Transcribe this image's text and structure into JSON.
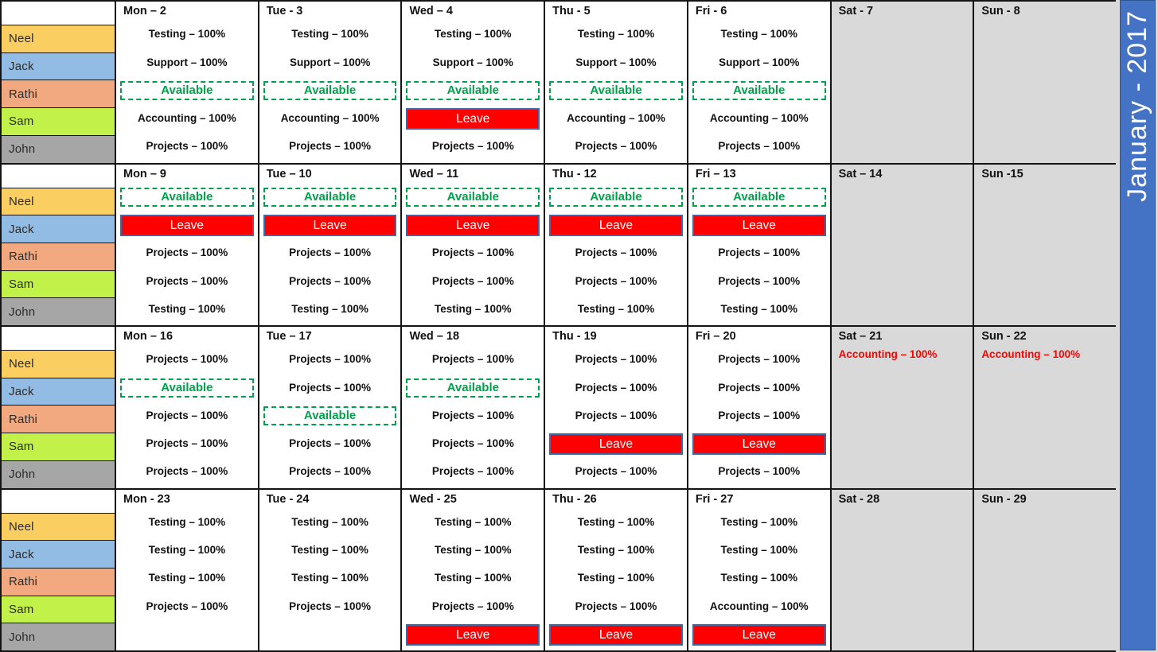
{
  "banner": {
    "month_year": "January - 2017",
    "accent": "#4472c4"
  },
  "resources": [
    {
      "name": "Neel",
      "color": "#fbce61"
    },
    {
      "name": "Jack",
      "color": "#92bce4"
    },
    {
      "name": "Rathi",
      "color": "#f2a97f"
    },
    {
      "name": "Sam",
      "color": "#c2f24a"
    },
    {
      "name": "John",
      "color": "#a6a6a6"
    }
  ],
  "status_colors": {
    "available_text": "#00a14b",
    "available_border": "#00a14b",
    "leave_bg": "#ff0000",
    "leave_border": "#3a68ab",
    "leave_text": "#ffffff",
    "weekend_bg": "#d9d9d9",
    "weekend_task_text": "#ff0000"
  },
  "weeks": [
    {
      "days": [
        {
          "label": "Mon – 2",
          "weekend": false,
          "slots": [
            {
              "type": "task",
              "text": "Testing – 100%"
            },
            {
              "type": "task",
              "text": "Support  – 100%"
            },
            {
              "type": "available",
              "text": "Available"
            },
            {
              "type": "task",
              "text": "Accounting  – 100%"
            },
            {
              "type": "task",
              "text": "Projects – 100%"
            }
          ]
        },
        {
          "label": "Tue - 3",
          "weekend": false,
          "slots": [
            {
              "type": "task",
              "text": "Testing – 100%"
            },
            {
              "type": "task",
              "text": "Support  – 100%"
            },
            {
              "type": "available",
              "text": "Available"
            },
            {
              "type": "task",
              "text": "Accounting  – 100%"
            },
            {
              "type": "task",
              "text": "Projects – 100%"
            }
          ]
        },
        {
          "label": "Wed – 4",
          "weekend": false,
          "slots": [
            {
              "type": "task",
              "text": "Testing – 100%"
            },
            {
              "type": "task",
              "text": "Support – 100%"
            },
            {
              "type": "available",
              "text": "Available"
            },
            {
              "type": "leave",
              "text": "Leave"
            },
            {
              "type": "task",
              "text": "Projects – 100%"
            }
          ]
        },
        {
          "label": "Thu - 5",
          "weekend": false,
          "slots": [
            {
              "type": "task",
              "text": "Testing – 100%"
            },
            {
              "type": "task",
              "text": "Support – 100%"
            },
            {
              "type": "available",
              "text": "Available"
            },
            {
              "type": "task",
              "text": "Accounting  – 100%"
            },
            {
              "type": "task",
              "text": "Projects – 100%"
            }
          ]
        },
        {
          "label": "Fri - 6",
          "weekend": false,
          "slots": [
            {
              "type": "task",
              "text": "Testing – 100%"
            },
            {
              "type": "task",
              "text": "Support – 100%"
            },
            {
              "type": "available",
              "text": "Available"
            },
            {
              "type": "task",
              "text": "Accounting  – 100%"
            },
            {
              "type": "task",
              "text": "Projects – 100%"
            }
          ]
        },
        {
          "label": "Sat - 7",
          "weekend": true,
          "slots": []
        },
        {
          "label": "Sun - 8",
          "weekend": true,
          "slots": []
        }
      ]
    },
    {
      "days": [
        {
          "label": "Mon – 9",
          "weekend": false,
          "slots": [
            {
              "type": "available",
              "text": "Available"
            },
            {
              "type": "leave",
              "text": "Leave"
            },
            {
              "type": "task",
              "text": "Projects – 100%"
            },
            {
              "type": "task",
              "text": "Projects – 100%"
            },
            {
              "type": "task",
              "text": "Testing – 100%"
            }
          ]
        },
        {
          "label": "Tue – 10",
          "weekend": false,
          "slots": [
            {
              "type": "available",
              "text": "Available"
            },
            {
              "type": "leave",
              "text": "Leave"
            },
            {
              "type": "task",
              "text": "Projects – 100%"
            },
            {
              "type": "task",
              "text": "Projects – 100%"
            },
            {
              "type": "task",
              "text": "Testing – 100%"
            }
          ]
        },
        {
          "label": "Wed – 11",
          "weekend": false,
          "slots": [
            {
              "type": "available",
              "text": "Available"
            },
            {
              "type": "leave",
              "text": "Leave"
            },
            {
              "type": "task",
              "text": "Projects – 100%"
            },
            {
              "type": "task",
              "text": "Projects – 100%"
            },
            {
              "type": "task",
              "text": "Testing – 100%"
            }
          ]
        },
        {
          "label": "Thu - 12",
          "weekend": false,
          "slots": [
            {
              "type": "available",
              "text": "Available"
            },
            {
              "type": "leave",
              "text": "Leave"
            },
            {
              "type": "task",
              "text": "Projects – 100%"
            },
            {
              "type": "task",
              "text": "Projects – 100%"
            },
            {
              "type": "task",
              "text": "Testing – 100%"
            }
          ]
        },
        {
          "label": "Fri – 13",
          "weekend": false,
          "slots": [
            {
              "type": "available",
              "text": "Available"
            },
            {
              "type": "leave",
              "text": "Leave"
            },
            {
              "type": "task",
              "text": "Projects – 100%"
            },
            {
              "type": "task",
              "text": "Projects – 100%"
            },
            {
              "type": "task",
              "text": "Testing – 100%"
            }
          ]
        },
        {
          "label": "Sat – 14",
          "weekend": true,
          "slots": []
        },
        {
          "label": "Sun -15",
          "weekend": true,
          "slots": []
        }
      ]
    },
    {
      "days": [
        {
          "label": "Mon – 16",
          "weekend": false,
          "slots": [
            {
              "type": "task",
              "text": "Projects – 100%"
            },
            {
              "type": "available",
              "text": "Available"
            },
            {
              "type": "task",
              "text": "Projects – 100%"
            },
            {
              "type": "task",
              "text": "Projects – 100%"
            },
            {
              "type": "task",
              "text": "Projects – 100%"
            }
          ]
        },
        {
          "label": "Tue – 17",
          "weekend": false,
          "slots": [
            {
              "type": "task",
              "text": "Projects – 100%"
            },
            {
              "type": "task",
              "text": "Projects – 100%"
            },
            {
              "type": "available",
              "text": "Available"
            },
            {
              "type": "task",
              "text": "Projects – 100%"
            },
            {
              "type": "task",
              "text": "Projects – 100%"
            }
          ]
        },
        {
          "label": "Wed – 18",
          "weekend": false,
          "slots": [
            {
              "type": "task",
              "text": "Projects – 100%"
            },
            {
              "type": "available",
              "text": "Available"
            },
            {
              "type": "task",
              "text": "Projects – 100%"
            },
            {
              "type": "task",
              "text": "Projects – 100%"
            },
            {
              "type": "task",
              "text": "Projects – 100%"
            }
          ]
        },
        {
          "label": "Thu - 19",
          "weekend": false,
          "slots": [
            {
              "type": "task",
              "text": "Projects – 100%"
            },
            {
              "type": "task",
              "text": "Projects – 100%"
            },
            {
              "type": "task",
              "text": "Projects – 100%"
            },
            {
              "type": "leave",
              "text": "Leave"
            },
            {
              "type": "task",
              "text": "Projects – 100%"
            }
          ]
        },
        {
          "label": "Fri – 20",
          "weekend": false,
          "slots": [
            {
              "type": "task",
              "text": "Projects – 100%"
            },
            {
              "type": "task",
              "text": "Projects – 100%"
            },
            {
              "type": "task",
              "text": "Projects – 100%"
            },
            {
              "type": "leave",
              "text": "Leave"
            },
            {
              "type": "task",
              "text": "Projects – 100%"
            }
          ]
        },
        {
          "label": "Sat – 21",
          "weekend": true,
          "slots": [
            {
              "type": "weekend-task",
              "text": "Accounting  – 100%"
            }
          ]
        },
        {
          "label": "Sun - 22",
          "weekend": true,
          "slots": [
            {
              "type": "weekend-task",
              "text": "Accounting  – 100%"
            }
          ]
        }
      ]
    },
    {
      "days": [
        {
          "label": "Mon - 23",
          "weekend": false,
          "slots": [
            {
              "type": "task",
              "text": "Testing – 100%"
            },
            {
              "type": "task",
              "text": "Testing – 100%"
            },
            {
              "type": "task",
              "text": "Testing – 100%"
            },
            {
              "type": "task",
              "text": "Projects – 100%"
            },
            {
              "type": "empty",
              "text": ""
            }
          ]
        },
        {
          "label": "Tue - 24",
          "weekend": false,
          "slots": [
            {
              "type": "task",
              "text": "Testing – 100%"
            },
            {
              "type": "task",
              "text": "Testing – 100%"
            },
            {
              "type": "task",
              "text": "Testing – 100%"
            },
            {
              "type": "task",
              "text": "Projects – 100%"
            },
            {
              "type": "empty",
              "text": ""
            }
          ]
        },
        {
          "label": "Wed - 25",
          "weekend": false,
          "slots": [
            {
              "type": "task",
              "text": "Testing – 100%"
            },
            {
              "type": "task",
              "text": "Testing – 100%"
            },
            {
              "type": "task",
              "text": "Testing – 100%"
            },
            {
              "type": "task",
              "text": "Projects – 100%"
            },
            {
              "type": "leave",
              "text": "Leave"
            }
          ]
        },
        {
          "label": "Thu - 26",
          "weekend": false,
          "slots": [
            {
              "type": "task",
              "text": "Testing – 100%"
            },
            {
              "type": "task",
              "text": "Testing – 100%"
            },
            {
              "type": "task",
              "text": "Testing – 100%"
            },
            {
              "type": "task",
              "text": "Projects – 100%"
            },
            {
              "type": "leave",
              "text": "Leave"
            }
          ]
        },
        {
          "label": "Fri - 27",
          "weekend": false,
          "slots": [
            {
              "type": "task",
              "text": "Testing – 100%"
            },
            {
              "type": "task",
              "text": "Testing – 100%"
            },
            {
              "type": "task",
              "text": "Testing – 100%"
            },
            {
              "type": "task",
              "text": "Accounting  – 100%"
            },
            {
              "type": "leave",
              "text": "Leave"
            }
          ]
        },
        {
          "label": "Sat - 28",
          "weekend": true,
          "slots": []
        },
        {
          "label": "Sun - 29",
          "weekend": true,
          "slots": []
        }
      ]
    }
  ]
}
